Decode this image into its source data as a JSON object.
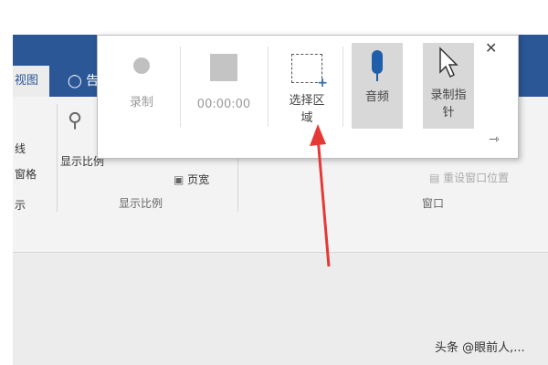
{
  "tabs": {
    "view": "视图",
    "tell_me_fragment": "告"
  },
  "ribbon": {
    "left_labels": [
      "线",
      "窗格",
      "示"
    ],
    "zoom_button": "显示比例",
    "page_width": "页宽",
    "group_zoom": "显示比例",
    "reset_window": "重设窗口位置",
    "group_window": "窗口"
  },
  "recorder": {
    "record_label": "录制",
    "time": "00:00:00",
    "select_area_line1": "选择区",
    "select_area_line2": "域",
    "audio_label": "音频",
    "pointer_line1": "录制指",
    "pointer_line2": "针"
  },
  "watermark": "头条 @眼前人,..."
}
